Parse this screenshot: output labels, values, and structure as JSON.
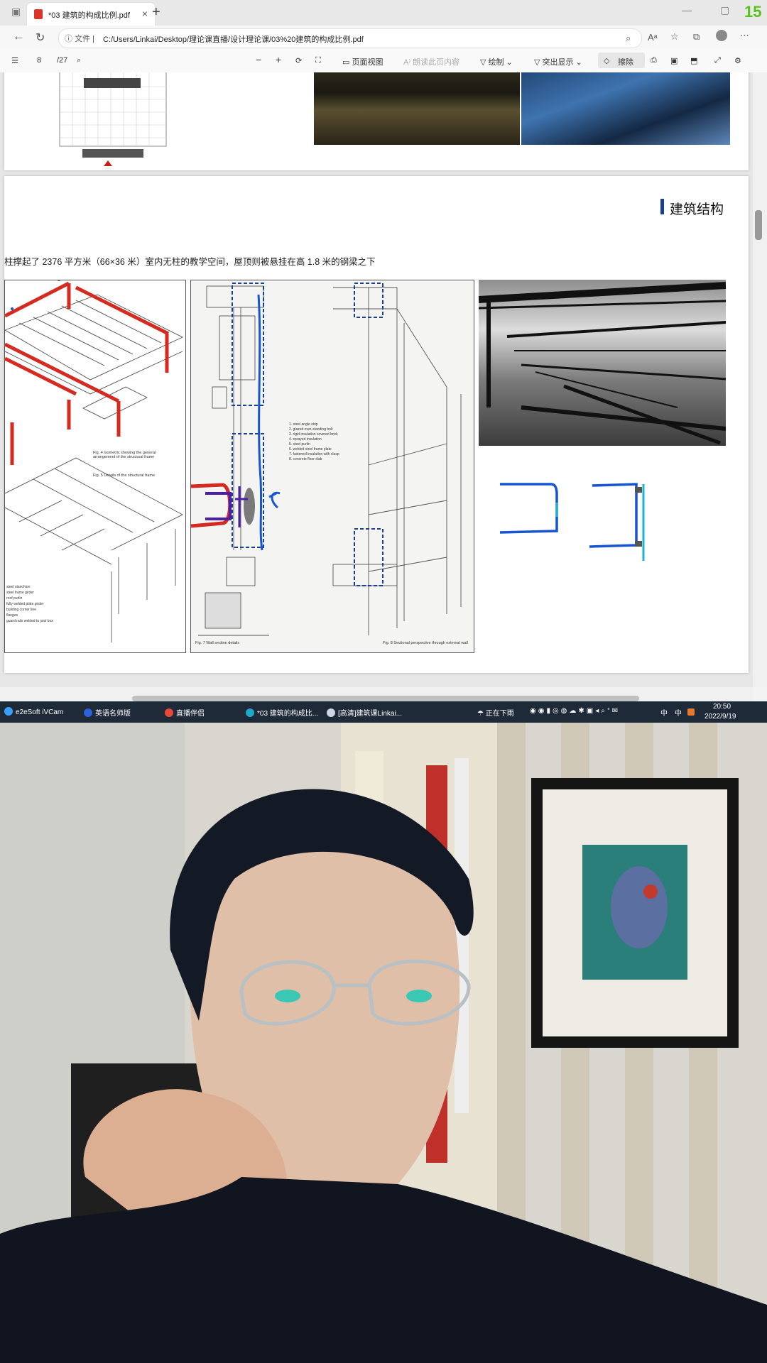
{
  "tab": {
    "title": "*03 建筑的构成比例.pdf"
  },
  "recording_number": "15",
  "address": {
    "info_label": "文件",
    "url": "C:/Users/Linkai/Desktop/理论课直播/设计理论课/03%20建筑的构成比例.pdf"
  },
  "pdf_toolbar": {
    "page_current": "8",
    "page_total": "/27",
    "page_view": "页面视图",
    "read_aloud": "朗读此页内容",
    "draw": "绘制",
    "highlight": "突出显示",
    "erase": "擦除"
  },
  "document": {
    "heading": "建筑结构",
    "caption": "柱撑起了 2376 平方米（66×36 米）室内无柱的教学空间，屋顶则被悬挂在高 1.8 米的钢梁之下",
    "fig4_caption": "Fig. 4   Isometric showing the general arrangement of the structural frame",
    "fig5_caption": "Fig. 5   Details of the structural frame",
    "fig7_caption": "Fig. 7   Wall section details",
    "fig8_caption": "Fig. 8   Sectional perspective through external wall",
    "legend_items": [
      "1.  steel angle strip",
      "2.  glazed over-standing bolt",
      "3.  rigid insulation covered brick",
      "4.  sprayed insulation",
      "5.  steel purlin",
      "6.  welded steel frame plate",
      "7.  fastened insulation with clasp",
      "8.  concrete floor slab"
    ],
    "fig5_legend": [
      "steel stanchion",
      "steel frame girder",
      "roof purlin",
      "fully welded plate girder",
      "building corner line",
      "flanges",
      "guard rails welded to joist box"
    ]
  },
  "taskbar": {
    "items": [
      "e2eSoft iVCam",
      "英语名师版",
      "直播伴侣",
      "*03 建筑的构成比...",
      "[高清]建筑课Linkai..."
    ],
    "weather": "正在下雨",
    "ime1": "中",
    "ime2": "中",
    "time": "20:50",
    "date": "2022/9/19"
  },
  "colors": {
    "annotation_red": "#d42a20",
    "annotation_blue": "#1655cf",
    "annotation_purple": "#4d1fa8",
    "annotation_cyan": "#1fb3cc",
    "heading_bar": "#1b3f8f",
    "rec_green": "#58c11e"
  }
}
